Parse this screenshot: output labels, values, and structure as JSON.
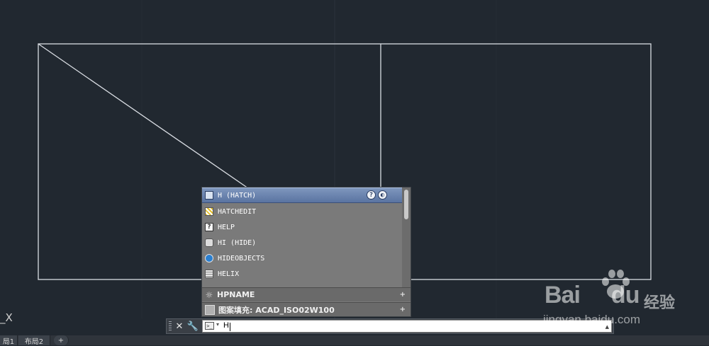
{
  "colors": {
    "background": "#212830",
    "linework": "#d9dde3",
    "popup_bg": "#7a7a7a",
    "popup_selected": "#6b84b0"
  },
  "autocomplete": {
    "items": [
      {
        "label": "H (HATCH)",
        "icon": "hatch-icon",
        "selected": true
      },
      {
        "label": "HATCHEDIT",
        "icon": "hatchedit-icon"
      },
      {
        "label": "HELP",
        "icon": "help-icon",
        "glyph": "?"
      },
      {
        "label": "HI (HIDE)",
        "icon": "hide-icon"
      },
      {
        "label": "HIDEOBJECTS",
        "icon": "hideobjects-icon"
      },
      {
        "label": "HELIX",
        "icon": "helix-icon"
      }
    ],
    "header_help_glyph": "?",
    "sections": [
      {
        "label": "HPNAME",
        "icon": "gear-icon",
        "glyph": "☼",
        "expand": "+"
      },
      {
        "label": "图案填充: ACAD_ISO02W100",
        "icon": "hatch-pattern-icon",
        "expand": "+"
      }
    ]
  },
  "command_line": {
    "close_glyph": "✕",
    "settings_glyph": "🔧",
    "prompt_glyph": ">_",
    "prompt_caret": "▾",
    "input_value": "H",
    "dropdown_glyph": "▲"
  },
  "layout_tabs": [
    {
      "label": "局1"
    },
    {
      "label": "布局2"
    },
    {
      "label": "+"
    }
  ],
  "ucs_label": "_X",
  "watermark": {
    "brand": "Bai",
    "brand_suffix": "du",
    "cn": "经验",
    "url": "jingyan.baidu.com"
  }
}
